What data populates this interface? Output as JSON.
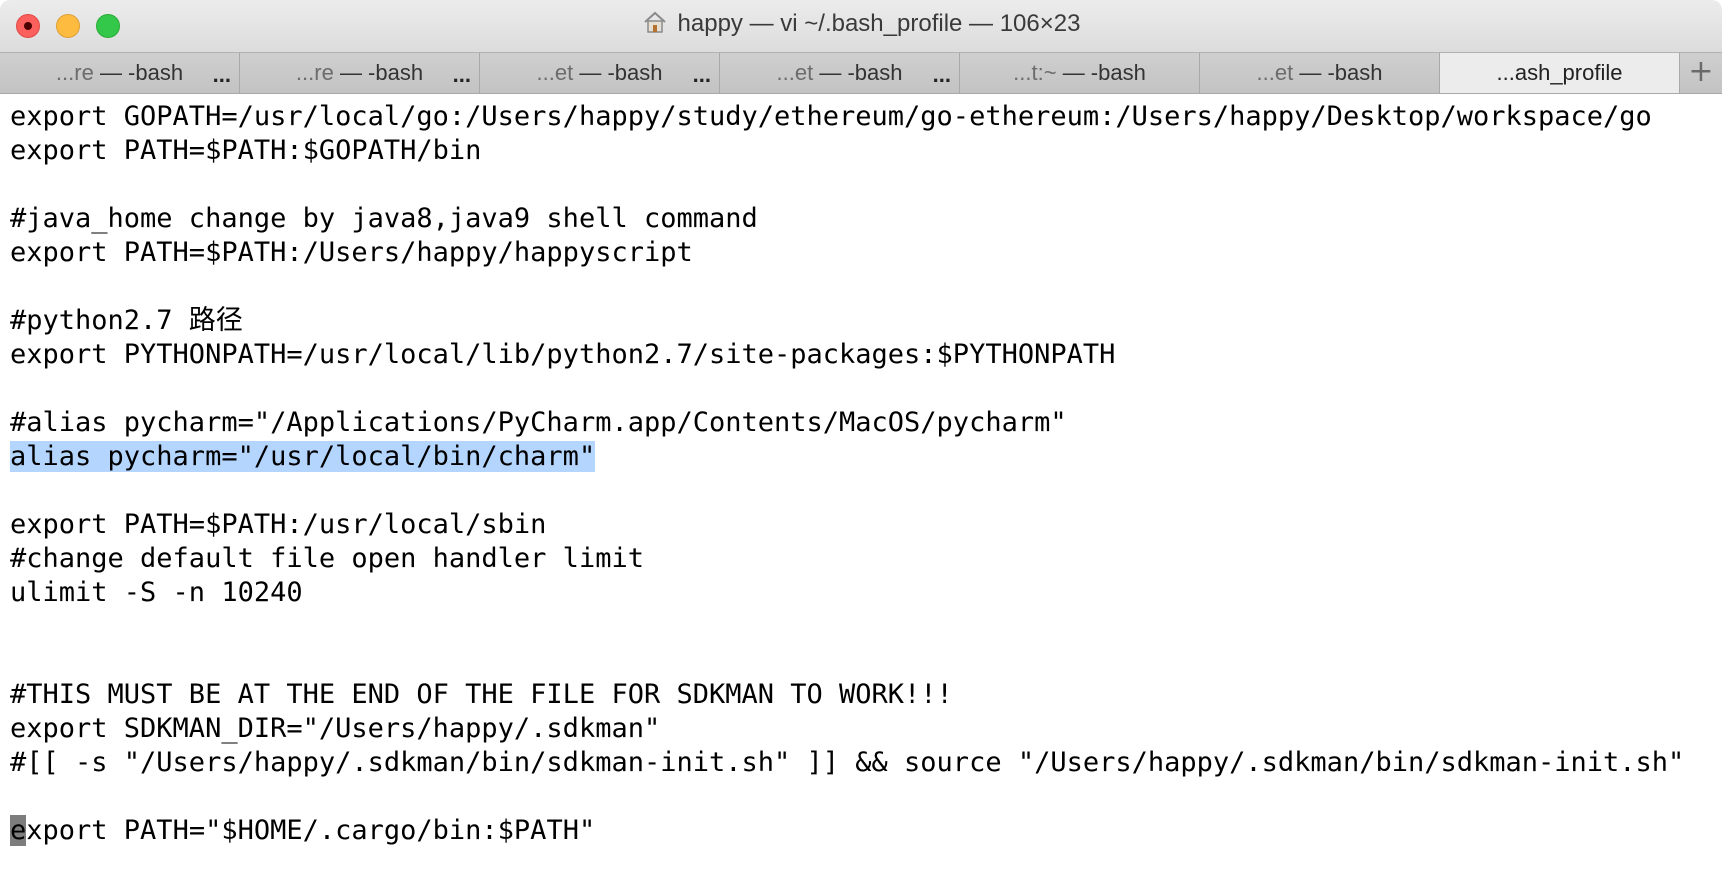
{
  "window": {
    "title": "happy — vi ~/.bash_profile — 106×23"
  },
  "tabs": [
    {
      "prefix": "...re",
      "label": "— -bash",
      "menu": "..."
    },
    {
      "prefix": "...re",
      "label": "— -bash",
      "menu": "..."
    },
    {
      "prefix": "...et",
      "label": "— -bash",
      "menu": "..."
    },
    {
      "prefix": "...et",
      "label": "— -bash",
      "menu": "..."
    },
    {
      "prefix": "...t:~",
      "label": "— -bash",
      "menu": ""
    },
    {
      "prefix": "...et",
      "label": "— -bash",
      "menu": ""
    },
    {
      "prefix": "",
      "label": "...ash_profile",
      "menu": ""
    }
  ],
  "new_tab_label": "+",
  "editor": {
    "lines": [
      "export GOPATH=/usr/local/go:/Users/happy/study/ethereum/go-ethereum:/Users/happy/Desktop/workspace/go",
      "export PATH=$PATH:$GOPATH/bin",
      "",
      "#java_home change by java8,java9 shell command",
      "export PATH=$PATH:/Users/happy/happyscript",
      "",
      "#python2.7 路径",
      "export PYTHONPATH=/usr/local/lib/python2.7/site-packages:$PYTHONPATH",
      "",
      "#alias pycharm=\"/Applications/PyCharm.app/Contents/MacOS/pycharm\"",
      "alias pycharm=\"/usr/local/bin/charm\"",
      "",
      "export PATH=$PATH:/usr/local/sbin",
      "#change default file open handler limit",
      "ulimit -S -n 10240",
      "",
      "",
      "#THIS MUST BE AT THE END OF THE FILE FOR SDKMAN TO WORK!!!",
      "export SDKMAN_DIR=\"/Users/happy/.sdkman\"",
      "#[[ -s \"/Users/happy/.sdkman/bin/sdkman-init.sh\" ]] && source \"/Users/happy/.sdkman/bin/sdkman-init.sh\"",
      "",
      "export PATH=\"$HOME/.cargo/bin:$PATH\""
    ],
    "last_line_cursor_char": "e",
    "last_line_rest": "xport PATH=\"$HOME/.cargo/bin:$PATH\""
  }
}
